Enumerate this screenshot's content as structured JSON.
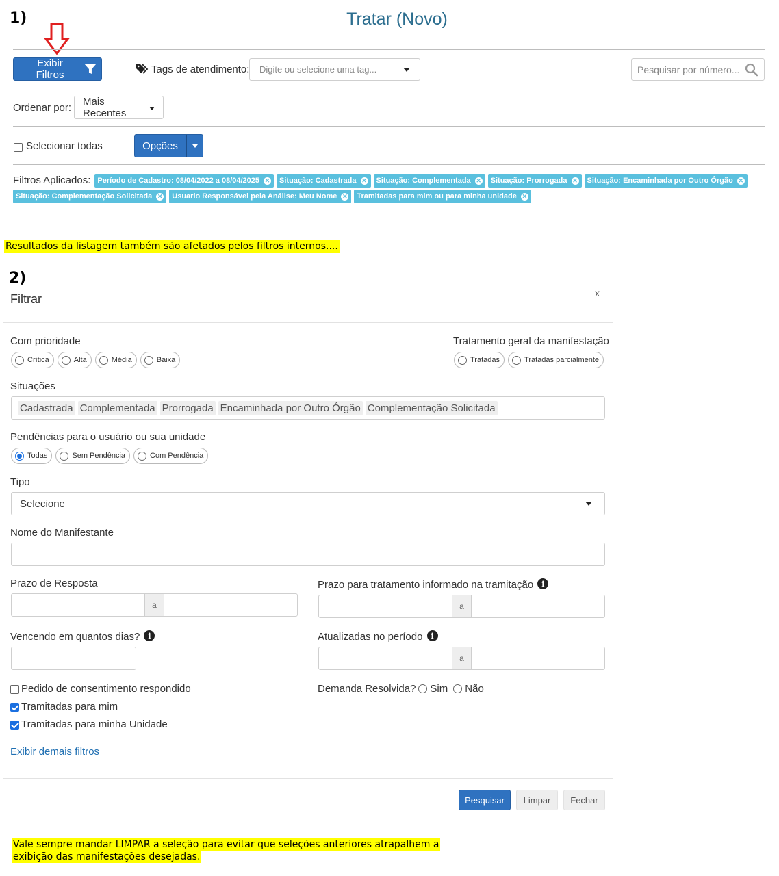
{
  "step1": {
    "number": "1)",
    "title": "Tratar (Novo)",
    "filters_button": "Exibir Filtros",
    "tags_label": "Tags de atendimento:",
    "tags_placeholder": "Digite ou selecione uma tag...",
    "search_placeholder": "Pesquisar por número...",
    "order_label": "Ordenar por:",
    "order_value": "Mais Recentes",
    "select_all_label": "Selecionar todas",
    "options_button": "Opções",
    "applied_filters_label": "Filtros Aplicados:",
    "applied_filters": [
      "Período de Cadastro: 08/04/2022 a 08/04/2025",
      "Situação: Cadastrada",
      "Situação: Complementada",
      "Situação: Prorrogada",
      "Situação: Encaminhada por Outro Órgão",
      "Situação: Complementação Solicitada",
      "Usuario Responsável pela Análise: Meu Nome",
      "Tramitadas para mim ou para minha unidade"
    ]
  },
  "note1": "Resultados da listagem também são afetados pelos filtros internos....",
  "step2": {
    "number": "2)",
    "panel_title": "Filtrar",
    "close_label": "x",
    "priority_label": "Com prioridade",
    "priority_options": [
      "Crítica",
      "Alta",
      "Média",
      "Baixa"
    ],
    "treatment_label": "Tratamento geral da manifestação",
    "treatment_options": [
      "Tratadas",
      "Tratadas parcialmente"
    ],
    "situations_label": "Situações",
    "situations": [
      "Cadastrada",
      "Complementada",
      "Prorrogada",
      "Encaminhada por Outro Órgão",
      "Complementação Solicitada"
    ],
    "pending_label": "Pendências para o usuário ou sua unidade",
    "pending_options": [
      "Todas",
      "Sem Pendência",
      "Com Pendência"
    ],
    "type_label": "Tipo",
    "type_value": "Selecione",
    "manifestant_label": "Nome do Manifestante",
    "deadline_label": "Prazo de Resposta",
    "range_sep": "a",
    "treatment_deadline_label": "Prazo para tratamento informado na tramitação",
    "due_label": "Vencendo em quantos dias?",
    "updated_label": "Atualizadas no período",
    "consent_label": "Pedido de consentimento respondido",
    "sent_to_me_label": "Tramitadas para mim",
    "sent_to_unit_label": "Tramitadas para minha Unidade",
    "resolved_label": "Demanda Resolvida?",
    "yes_label": "Sim",
    "no_label": "Não",
    "more_filters_link": "Exibir demais filtros",
    "search_button": "Pesquisar",
    "clear_button": "Limpar",
    "close_button": "Fechar"
  },
  "note2_line1": "Vale sempre mandar LIMPAR a seleção para evitar que seleções anteriores atrapalhem a",
  "note2_line2": "exibição das manifestações desejadas.",
  "colors": {
    "primary": "#2f72c0",
    "chip": "#5ac0de",
    "title": "#2c6e8f",
    "highlight": "#ffff00",
    "arrow": "#e02020"
  },
  "icons": [
    "down-arrow-annotation-icon",
    "filter-funnel-icon",
    "tags-icon",
    "search-icon",
    "info-icon",
    "caret-down-icon",
    "remove-chip-icon"
  ]
}
